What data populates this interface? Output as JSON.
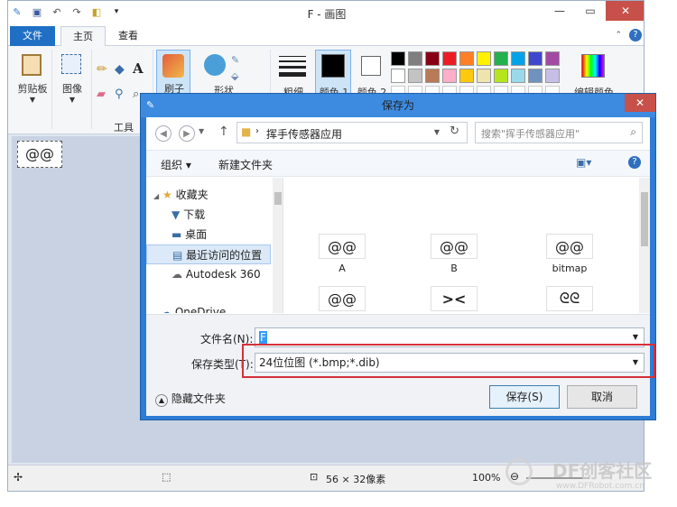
{
  "window": {
    "title": "F - 画图",
    "tabs": {
      "file": "文件",
      "home": "主页",
      "view": "查看"
    }
  },
  "ribbon": {
    "clipboard": "剪贴板",
    "image": "图像",
    "tools": "工具",
    "brush": "刷子",
    "shapes": "形状",
    "size": "粗细",
    "color1": "颜色 1",
    "color2": "颜色 2",
    "edit_colors": "编辑颜色"
  },
  "palette": {
    "row1": [
      "#000000",
      "#7f7f7f",
      "#880015",
      "#ed1c24",
      "#ff7f27",
      "#fff200",
      "#22b14c",
      "#00a2e8",
      "#3f48cc",
      "#a349a4"
    ],
    "row2": [
      "#ffffff",
      "#c3c3c3",
      "#b97a57",
      "#ffaec9",
      "#ffc90e",
      "#efe4b0",
      "#b5e61d",
      "#99d9ea",
      "#7092be",
      "#c8bfe7"
    ]
  },
  "status": {
    "size": "56 × 32像素",
    "zoom": "100%"
  },
  "dialog": {
    "title": "保存为",
    "path": "挥手传感器应用",
    "search_placeholder": "搜索\"挥手传感器应用\"",
    "organize": "组织 ▾",
    "new_folder": "新建文件夹",
    "nav": [
      "收藏夹",
      "下载",
      "桌面",
      "最近访问的位置",
      "Autodesk 360",
      "OneDrive"
    ],
    "files": [
      "A",
      "B",
      "bitmap"
    ],
    "filename_label": "文件名(N):",
    "filename_value": "F",
    "filetype_label": "保存类型(T):",
    "filetype_value": "24位位图 (*.bmp;*.dib)",
    "hide_folders": "隐藏文件夹",
    "save": "保存(S)",
    "cancel": "取消"
  },
  "watermark": {
    "brand": "DF创客社区",
    "url": "www.DFRobot.com.cn"
  }
}
